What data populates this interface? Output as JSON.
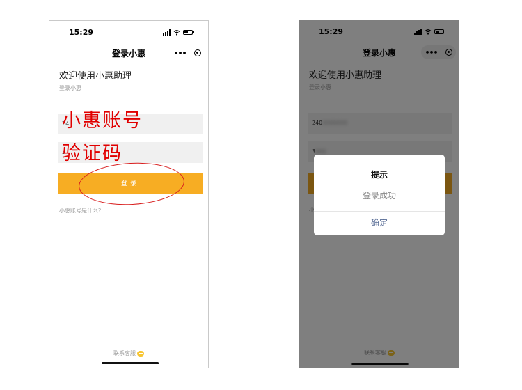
{
  "status_bar": {
    "time": "15:29"
  },
  "nav": {
    "title": "登录小惠",
    "more_glyph": "•••"
  },
  "page": {
    "welcome": "欢迎使用小惠助理",
    "subtitle": "登录小惠",
    "account_value": "240",
    "account_hidden": "0000000",
    "code_value": "3",
    "code_hidden": "000",
    "login_label": "登录",
    "help_link": "小惠账号是什么?",
    "service_link": "联系客服"
  },
  "left_phone": {
    "account_value": "24",
    "help_link_partial": "小惠账号是什么?"
  },
  "right_phone": {
    "help_link_partial": "小"
  },
  "annotations": {
    "account_label": "小惠账号",
    "code_label": "验证码"
  },
  "dialog": {
    "title": "提示",
    "message": "登录成功",
    "confirm_label": "确定"
  },
  "colors": {
    "accent": "#f7ad23",
    "annotation": "#e10000",
    "dialog_confirm": "#576b95"
  }
}
